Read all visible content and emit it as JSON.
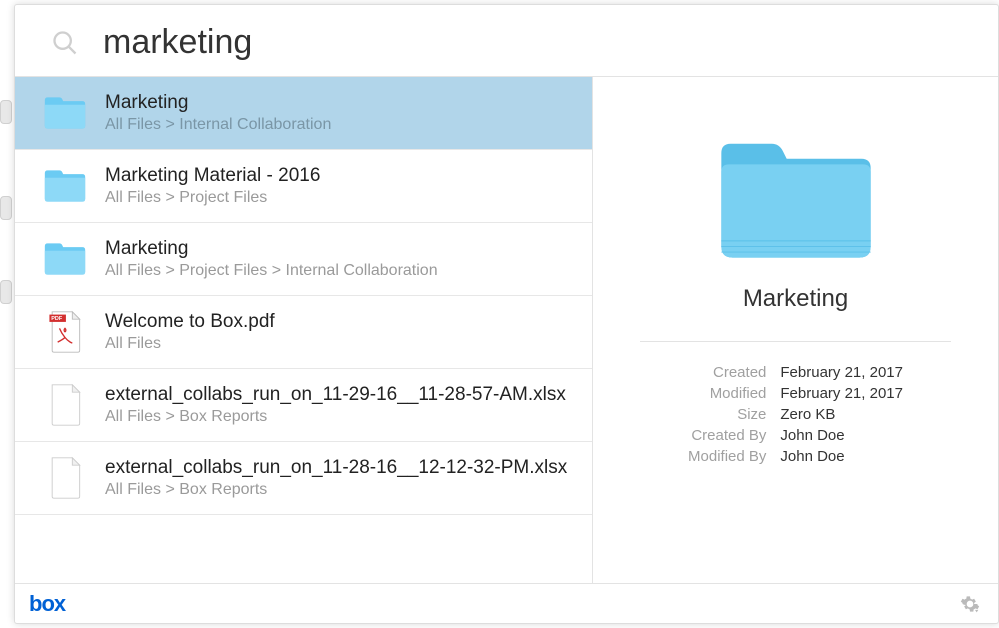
{
  "search": {
    "query": "marketing"
  },
  "results": [
    {
      "icon": "folder-icon",
      "title": "Marketing",
      "path": "All Files > Internal Collaboration",
      "selected": true
    },
    {
      "icon": "folder-icon",
      "title": "Marketing Material - 2016",
      "path": "All Files > Project Files",
      "selected": false
    },
    {
      "icon": "folder-icon",
      "title": "Marketing",
      "path": "All Files > Project Files > Internal Collaboration",
      "selected": false
    },
    {
      "icon": "pdf-icon",
      "title": "Welcome to Box.pdf",
      "path": "All Files",
      "selected": false
    },
    {
      "icon": "file-icon",
      "title": "external_collabs_run_on_11-29-16__11-28-57-AM.xlsx",
      "path": "All Files > Box Reports",
      "selected": false
    },
    {
      "icon": "file-icon",
      "title": "external_collabs_run_on_11-28-16__12-12-32-PM.xlsx",
      "path": "All Files > Box Reports",
      "selected": false
    }
  ],
  "detail": {
    "title": "Marketing",
    "created_label": "Created",
    "created_value": "February 21, 2017",
    "modified_label": "Modified",
    "modified_value": "February 21, 2017",
    "size_label": "Size",
    "size_value": "Zero KB",
    "createdby_label": "Created By",
    "createdby_value": "John Doe",
    "modifiedby_label": "Modified By",
    "modifiedby_value": "John Doe"
  },
  "footer": {
    "logo": "box"
  }
}
